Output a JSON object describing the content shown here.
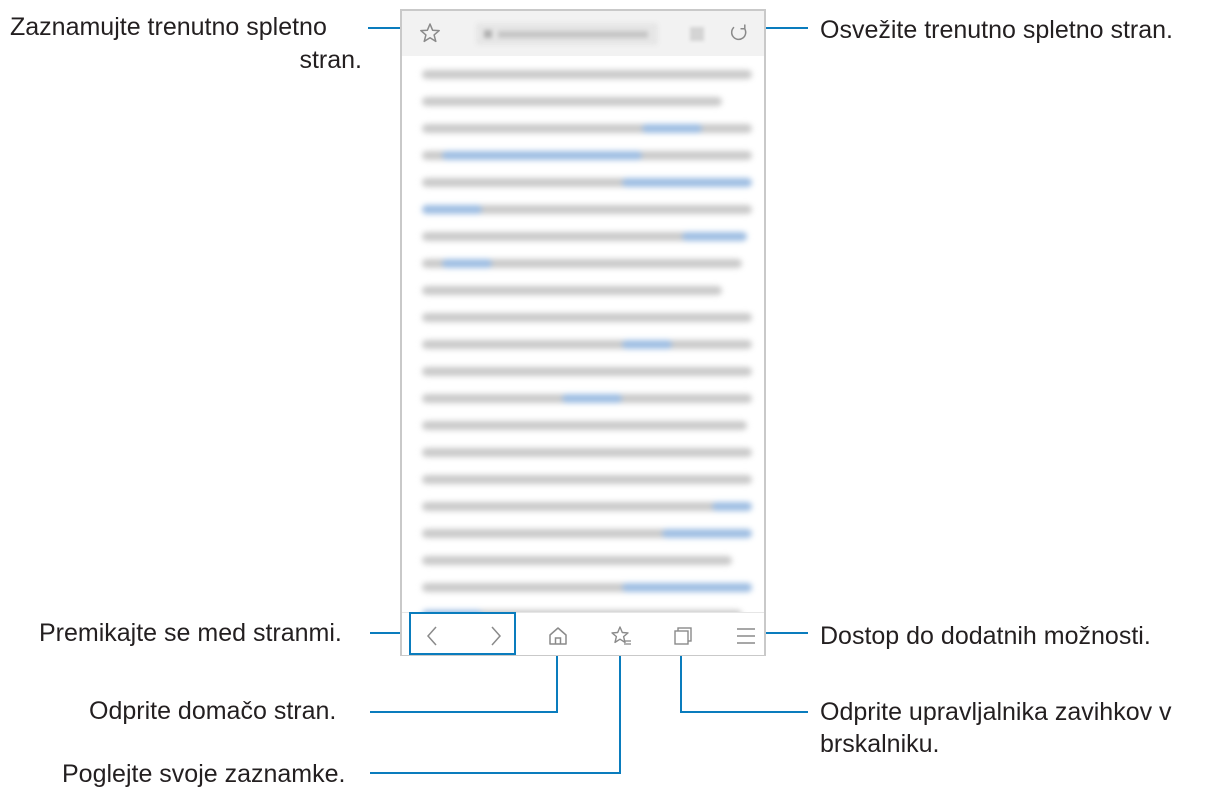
{
  "callouts": {
    "bookmark": "Zaznamujte trenutno spletno",
    "bookmark_2": "stran.",
    "refresh": "Osvežite trenutno spletno stran.",
    "navigate": "Premikajte se med stranmi.",
    "more_options": "Dostop do dodatnih možnosti.",
    "home": "Odprite domačo stran.",
    "tabs_manager": "Odprite upravljalnika zavihkov v",
    "tabs_manager_2": "brskalniku.",
    "view_bookmarks": "Poglejte svoje zaznamke."
  },
  "icons": [
    "star-icon",
    "refresh-icon",
    "back-icon",
    "forward-icon",
    "home-icon",
    "bookmarks-icon",
    "tabs-icon",
    "menu-icon"
  ],
  "colors": {
    "accent": "#0a7cbd",
    "icon": "#8a8a8a",
    "text": "#231f20"
  }
}
